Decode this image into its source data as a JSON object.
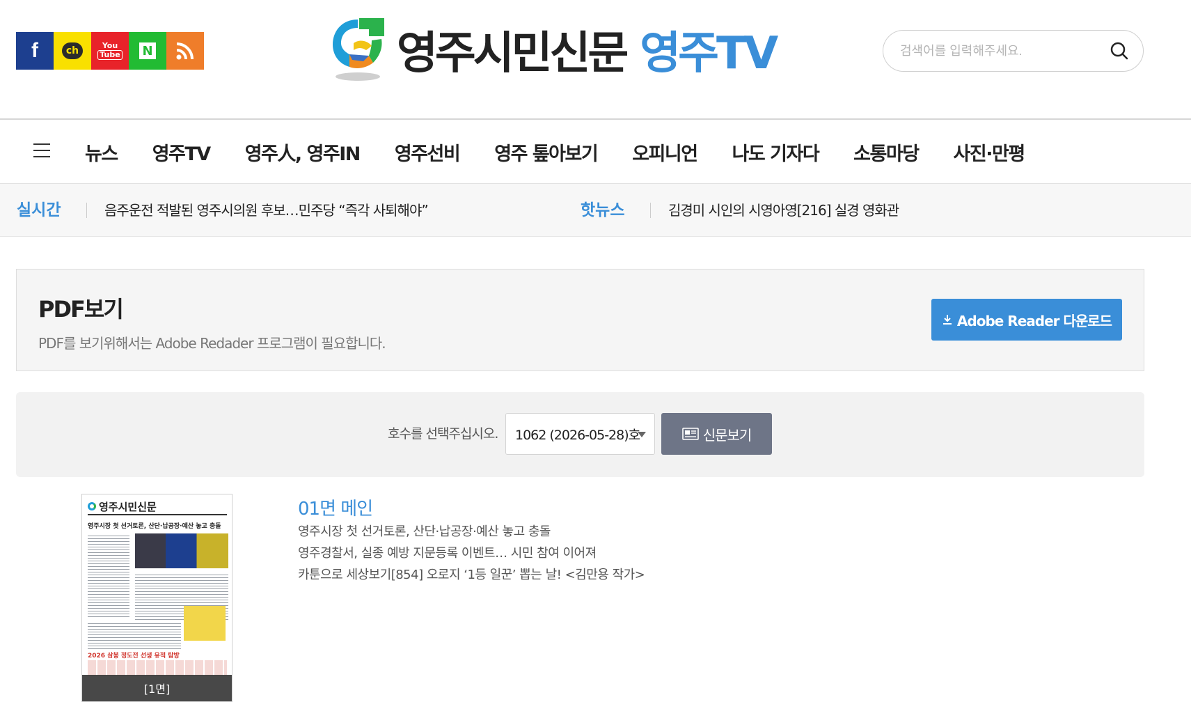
{
  "social": [
    {
      "name": "facebook",
      "glyph": "f"
    },
    {
      "name": "kakao-channel",
      "glyph": "ch"
    },
    {
      "name": "youtube",
      "glyph_top": "You",
      "glyph_bottom": "Tube"
    },
    {
      "name": "naver",
      "glyph": "N"
    },
    {
      "name": "rss",
      "glyph": ""
    }
  ],
  "brand": {
    "name": "영주시민신문",
    "tv": "영주TV"
  },
  "search": {
    "placeholder": "검색어를 입력해주세요."
  },
  "nav": {
    "items": [
      "뉴스",
      "영주TV",
      "영주人, 영주IN",
      "영주선비",
      "영주 톺아보기",
      "오피니언",
      "나도 기자다",
      "소통마당",
      "사진·만평"
    ]
  },
  "ticker": {
    "realtime_label": "실시간",
    "realtime_text": "음주운전 적발된 영주시의원 후보…민주당 “즉각 사퇴해야”",
    "hot_label": "핫뉴스",
    "hot_text": "김경미 시인의 시영아영[216] 실경 영화관"
  },
  "pdf": {
    "title": "PDF보기",
    "desc": "PDF를 보기위해서는 Adobe Redader 프로그램이 필요합니다.",
    "adobe_button": "Adobe Reader 다운로드"
  },
  "selector": {
    "label": "호수를 선택주십시오.",
    "selected": "1062 (2026-05-28)호",
    "view_button": "신문보기"
  },
  "issue": {
    "page_label": "[1면]",
    "title": "01면 메인",
    "lines": [
      "영주시장 첫 선거토론, 산단·납공장·예산 놓고 충돌",
      "영주경찰서, 실종 예방 지문등록 이벤트… 시민 참여 이어져",
      "카툰으로 세상보기[854] 오로지 ‘1등 일꾼’ 뽑는 날! <김만용 작가>"
    ],
    "thumb_masthead": "영주시민신문",
    "thumb_headline": "영주시장 첫 선거토론, 산단·납공장·예산 놓고 충돌",
    "thumb_banner": "2026 삼봉 정도전 선생 유적 탐방"
  },
  "colors": {
    "accent": "#3a8ed8",
    "button_gray": "#6e7587",
    "facebook": "#1d3f8f",
    "kakao": "#f9e000",
    "youtube": "#e8232a",
    "naver": "#22bb33",
    "rss": "#ef7d2a"
  }
}
